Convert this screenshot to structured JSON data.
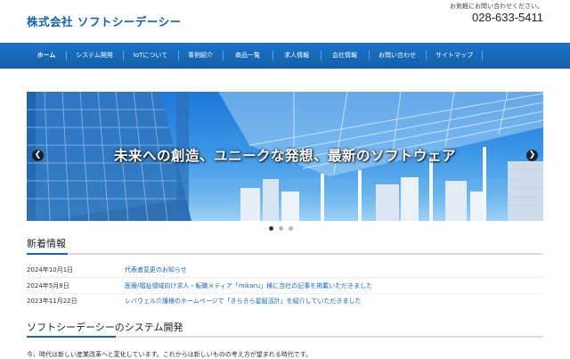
{
  "header": {
    "company_name": "株式会社 ソフトシーデーシー",
    "contact_note": "お気軽にお問い合わせください。",
    "phone": "028-633-5411"
  },
  "nav": {
    "items": [
      {
        "label": "ホーム",
        "active": true
      },
      {
        "label": "システム開発"
      },
      {
        "label": "IoTについて"
      },
      {
        "label": "事例紹介"
      },
      {
        "label": "商品一覧"
      },
      {
        "label": "求人情報"
      },
      {
        "label": "会社情報"
      },
      {
        "label": "お問い合わせ"
      },
      {
        "label": "サイトマップ"
      }
    ]
  },
  "slider": {
    "caption": "未来への創造、ユニークな発想、最新のソフトウェア",
    "prev_icon": "chevron-left-icon",
    "next_icon": "chevron-right-icon",
    "slide_count": 3,
    "active_index": 0
  },
  "news": {
    "title": "新着情報",
    "items": [
      {
        "date": "2024年10月1日",
        "text": "代表者変更のお知らせ"
      },
      {
        "date": "2024年5月8日",
        "text": "医療/福祉領域向け求人・転職メディア「mikaru」様に当社の記事を掲載いただきました"
      },
      {
        "date": "2023年11月22日",
        "text": "レバウェル介護様のホームページで「きらきら星脳活計」を紹介していただきました"
      }
    ]
  },
  "system_dev": {
    "title": "ソフトシーデーシーのシステム開発",
    "text": "今、時代は新しい産業改革へと変化しています。これからは新しいものの考え方が望まれる時代です。"
  },
  "colors": {
    "brand": "#1468b8",
    "link": "#1565c0"
  }
}
